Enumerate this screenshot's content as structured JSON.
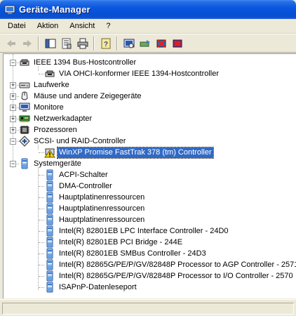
{
  "window": {
    "title": "Geräte-Manager"
  },
  "menu": [
    {
      "label": "Datei"
    },
    {
      "label": "Aktion"
    },
    {
      "label": "Ansicht"
    },
    {
      "label": "?"
    }
  ],
  "toolbar": {
    "buttons": [
      "back-icon",
      "forward-icon",
      "show-hide-console-tree-icon",
      "properties-icon",
      "print-icon",
      "help-icon",
      "scan-hardware-icon",
      "update-driver-icon",
      "disable-device-icon",
      "uninstall-device-icon"
    ]
  },
  "tree": {
    "items": [
      {
        "label": "IEEE 1394 Bus-Hostcontroller",
        "level": 1,
        "expander": "−",
        "icon": "ieee1394-icon"
      },
      {
        "label": "VIA OHCI-konformer IEEE 1394-Hostcontroller",
        "level": 2,
        "icon": "ieee1394-icon"
      },
      {
        "label": "Laufwerke",
        "level": 1,
        "expander": "+",
        "icon": "disk-drive-icon"
      },
      {
        "label": "Mäuse und andere Zeigegeräte",
        "level": 1,
        "expander": "+",
        "icon": "mouse-icon"
      },
      {
        "label": "Monitore",
        "level": 1,
        "expander": "+",
        "icon": "monitor-icon"
      },
      {
        "label": "Netzwerkadapter",
        "level": 1,
        "expander": "+",
        "icon": "network-adapter-icon"
      },
      {
        "label": "Prozessoren",
        "level": 1,
        "expander": "+",
        "icon": "processor-icon"
      },
      {
        "label": "SCSI- und RAID-Controller",
        "level": 1,
        "expander": "−",
        "icon": "scsi-icon"
      },
      {
        "label": "WinXP Promise FastTrak 378 (tm) Controller",
        "level": 2,
        "icon": "warning-device-icon",
        "selected": true
      },
      {
        "label": "Systemgeräte",
        "level": 1,
        "expander": "−",
        "icon": "system-device-icon"
      },
      {
        "label": "ACPI-Schalter",
        "level": 2,
        "icon": "system-device-icon"
      },
      {
        "label": "DMA-Controller",
        "level": 2,
        "icon": "system-device-icon"
      },
      {
        "label": "Hauptplatinenressourcen",
        "level": 2,
        "icon": "system-device-icon"
      },
      {
        "label": "Hauptplatinenressourcen",
        "level": 2,
        "icon": "system-device-icon"
      },
      {
        "label": "Hauptplatinenressourcen",
        "level": 2,
        "icon": "system-device-icon"
      },
      {
        "label": "Intel(R) 82801EB LPC Interface Controller - 24D0",
        "level": 2,
        "icon": "system-device-icon"
      },
      {
        "label": "Intel(R) 82801EB PCI Bridge - 244E",
        "level": 2,
        "icon": "system-device-icon"
      },
      {
        "label": "Intel(R) 82801EB SMBus Controller - 24D3",
        "level": 2,
        "icon": "system-device-icon"
      },
      {
        "label": "Intel(R) 82865G/PE/P/GV/82848P Processor to AGP Controller - 2571",
        "level": 2,
        "icon": "system-device-icon"
      },
      {
        "label": "Intel(R) 82865G/PE/P/GV/82848P Processor to I/O Controller - 2570",
        "level": 2,
        "icon": "system-device-icon"
      },
      {
        "label": "ISAPnP-Datenleseport",
        "level": 2,
        "icon": "system-device-icon"
      }
    ]
  },
  "colors": {
    "selection": "#316AC5",
    "titlebar": "#0A58DE",
    "chrome": "#ECE9D8"
  }
}
